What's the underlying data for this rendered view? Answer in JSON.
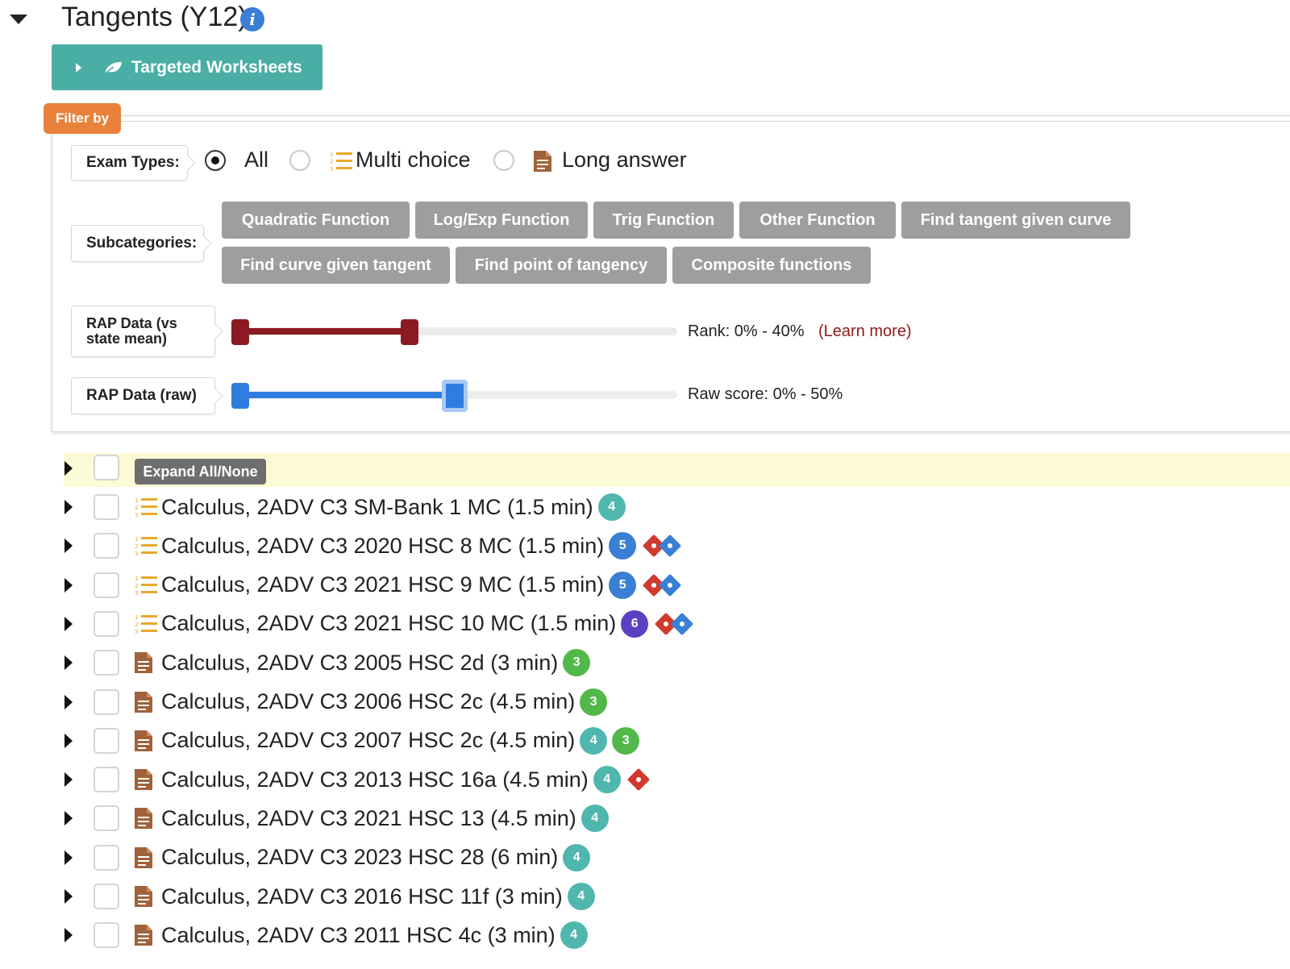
{
  "header": {
    "title": "Tangents (Y12)",
    "info_icon": "info-circle-icon",
    "worksheets_button": "Targeted Worksheets",
    "worksheets_icon": "leaf-icon"
  },
  "filter": {
    "tag_label": "Filter by",
    "exam_types_label": "Exam Types:",
    "exam_options": [
      "All",
      "Multi choice",
      "Long answer"
    ],
    "exam_selected": "All",
    "subcategories_label": "Subcategories:",
    "subcategories": [
      "Quadratic Function",
      "Log/Exp Function",
      "Trig Function",
      "Other Function",
      "Find tangent given curve",
      "Find curve given tangent",
      "Find point of tangency",
      "Composite functions"
    ],
    "rap_mean_label": "RAP Data (vs state mean)",
    "rap_mean_range": [
      0,
      40
    ],
    "rap_mean_readout": "Rank: 0% - 40%",
    "learn_more": "(Learn more)",
    "rap_raw_label": "RAP Data (raw)",
    "rap_raw_range": [
      0,
      50
    ],
    "rap_raw_readout": "Raw score: 0% - 50%"
  },
  "list": {
    "expand_label": "Expand All/None",
    "rows": [
      {
        "type": "mc",
        "text": "Calculus, 2ADV C3 SM-Bank 1 MC (1.5 min)",
        "badges": [
          "4"
        ],
        "diamonds": []
      },
      {
        "type": "mc",
        "text": "Calculus, 2ADV C3 2020 HSC 8 MC (1.5 min)",
        "badges": [
          "5"
        ],
        "diamonds": [
          "red",
          "blue"
        ]
      },
      {
        "type": "mc",
        "text": "Calculus, 2ADV C3 2021 HSC 9 MC (1.5 min)",
        "badges": [
          "5"
        ],
        "diamonds": [
          "red",
          "blue"
        ]
      },
      {
        "type": "mc",
        "text": "Calculus, 2ADV C3 2021 HSC 10 MC (1.5 min)",
        "badges": [
          "6"
        ],
        "diamonds": [
          "red",
          "blue"
        ]
      },
      {
        "type": "la",
        "text": "Calculus, 2ADV C3 2005 HSC 2d (3 min)",
        "badges": [
          "3"
        ],
        "diamonds": []
      },
      {
        "type": "la",
        "text": "Calculus, 2ADV C3 2006 HSC 2c (4.5 min)",
        "badges": [
          "3"
        ],
        "diamonds": []
      },
      {
        "type": "la",
        "text": "Calculus, 2ADV C3 2007 HSC 2c (4.5 min)",
        "badges": [
          "4",
          "3"
        ],
        "diamonds": []
      },
      {
        "type": "la",
        "text": "Calculus, 2ADV C3 2013 HSC 16a (4.5 min)",
        "badges": [
          "4"
        ],
        "diamonds": [
          "red"
        ]
      },
      {
        "type": "la",
        "text": "Calculus, 2ADV C3 2021 HSC 13 (4.5 min)",
        "badges": [
          "4"
        ],
        "diamonds": []
      },
      {
        "type": "la",
        "text": "Calculus, 2ADV C3 2023 HSC 28 (6 min)",
        "badges": [
          "4"
        ],
        "diamonds": []
      },
      {
        "type": "la",
        "text": "Calculus, 2ADV C3 2016 HSC 11f (3 min)",
        "badges": [
          "4"
        ],
        "diamonds": []
      },
      {
        "type": "la",
        "text": "Calculus, 2ADV C3 2011 HSC 4c (3 min)",
        "badges": [
          "4"
        ],
        "diamonds": []
      }
    ]
  },
  "colors": {
    "accent_teal": "#4aaea5",
    "filter_orange": "#e8823a",
    "chip_grey": "#9e9e9e",
    "rank_red": "#8b1a22",
    "raw_blue": "#2f7de1",
    "badge_3": "#52b849",
    "badge_4": "#4fb7ae",
    "badge_5": "#3a7fd5",
    "badge_6": "#5b3fc4",
    "diamond_red": "#d13a2f",
    "diamond_blue": "#3a7fd5"
  }
}
